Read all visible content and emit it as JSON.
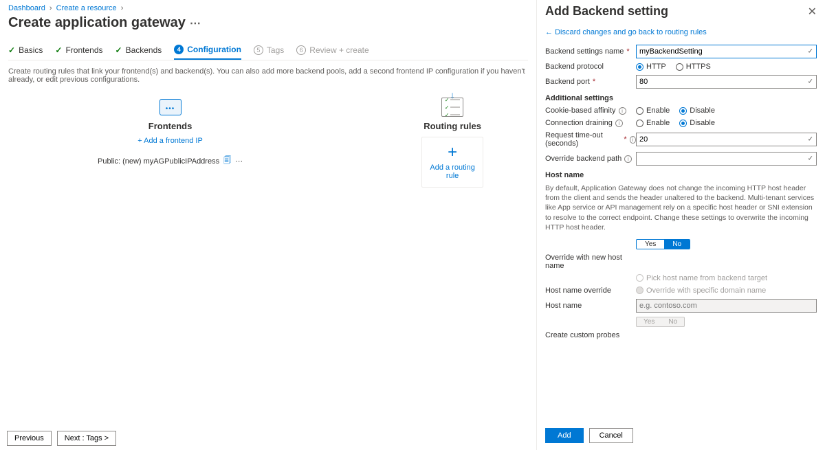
{
  "breadcrumb": {
    "items": [
      "Dashboard",
      "Create a resource"
    ]
  },
  "page_title": "Create application gateway",
  "tabs": {
    "basics": "Basics",
    "frontends": "Frontends",
    "backends": "Backends",
    "configuration": "Configuration",
    "tags_num": "5",
    "tags": "Tags",
    "review_num": "6",
    "review": "Review + create"
  },
  "description": "Create routing rules that link your frontend(s) and backend(s). You can also add more backend pools, add a second frontend IP configuration if you haven't already, or edit previous configurations.",
  "frontends": {
    "title": "Frontends",
    "add_link": "+ Add a frontend IP",
    "public_label": "Public: (new) myAGPublicIPAddress"
  },
  "routing": {
    "title": "Routing rules",
    "add_rule": "Add a routing rule"
  },
  "footer": {
    "previous": "Previous",
    "next": "Next : Tags >"
  },
  "panel": {
    "title": "Add Backend setting",
    "back": "Discard changes and go back to routing rules",
    "labels": {
      "name": "Backend settings name",
      "protocol": "Backend protocol",
      "port": "Backend port",
      "additional": "Additional settings",
      "affinity": "Cookie-based affinity",
      "draining": "Connection draining",
      "timeout": "Request time-out (seconds)",
      "override_path": "Override backend path",
      "hostname_h": "Host name",
      "override_new": "Override with new host name",
      "host_override": "Host name override",
      "host_name_l": "Host name",
      "probes": "Create custom probes"
    },
    "values": {
      "name": "myBackendSetting",
      "port": "80",
      "timeout": "20",
      "hostname_placeholder": "e.g. contoso.com"
    },
    "radios": {
      "http": "HTTP",
      "https": "HTTPS",
      "enable": "Enable",
      "disable": "Disable",
      "pick": "Pick host name from backend target",
      "override_specific": "Override with specific domain name",
      "yes": "Yes",
      "no": "No"
    },
    "hint": "By default, Application Gateway does not change the incoming HTTP host header from the client and sends the header unaltered to the backend. Multi-tenant services like App service or API management rely on a specific host header or SNI extension to resolve to the correct endpoint. Change these settings to overwrite the incoming HTTP host header.",
    "buttons": {
      "add": "Add",
      "cancel": "Cancel"
    }
  }
}
